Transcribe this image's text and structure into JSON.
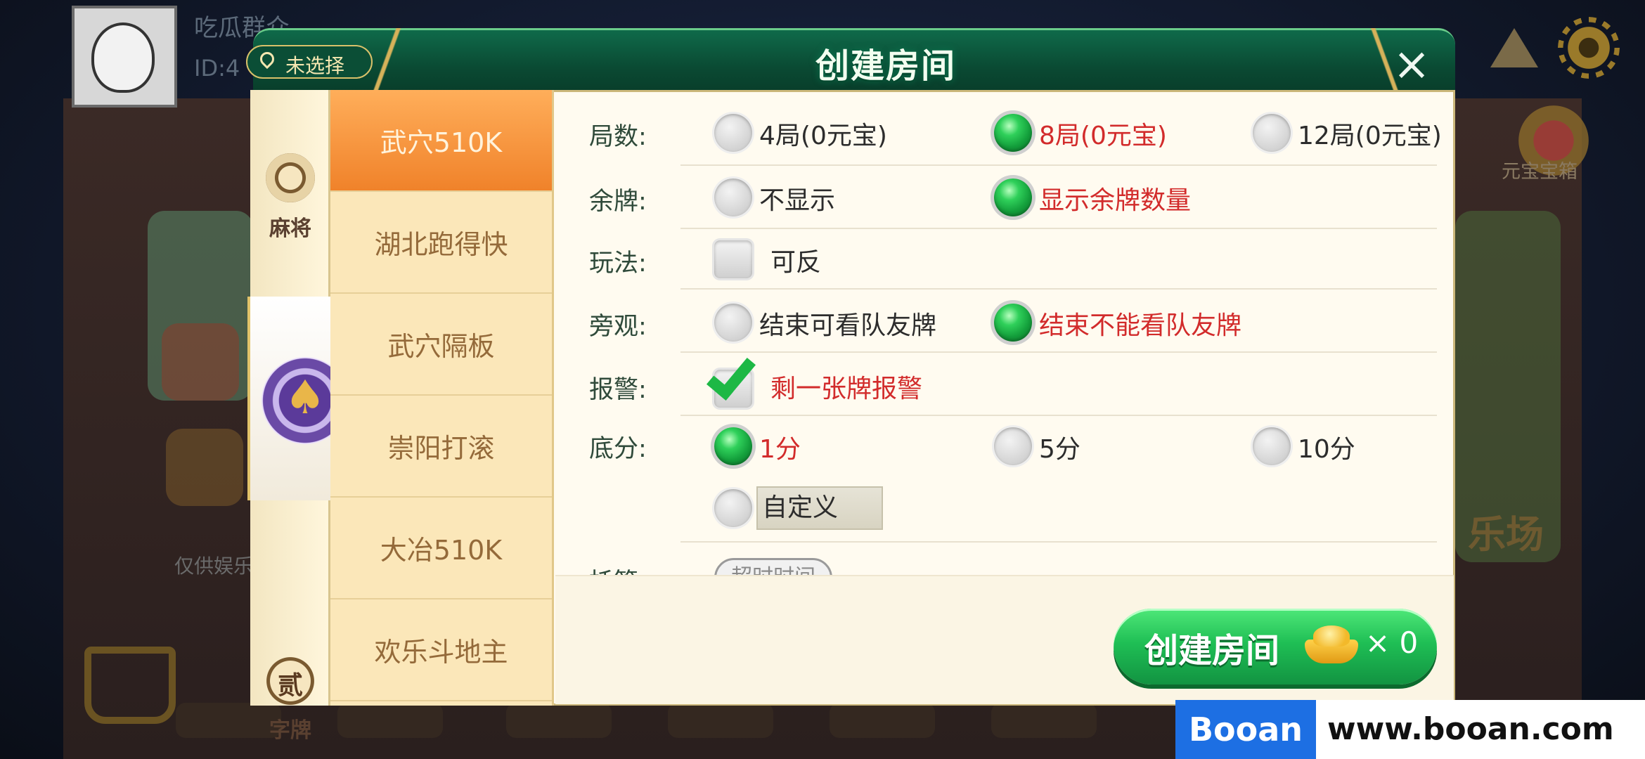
{
  "background": {
    "player_name": "吃瓜群众",
    "player_id": "ID:4",
    "treasure_label": "元宝宝箱",
    "left_caption": "仅供娱乐",
    "right_label": "乐场"
  },
  "header": {
    "title": "创建房间",
    "location_label": "未选择",
    "close_label": "×"
  },
  "categories": [
    {
      "label": "麻将",
      "icon": "mahjong-emblem-icon"
    },
    {
      "label": "",
      "icon": "spade-badge-icon",
      "selected": true
    },
    {
      "label": "字牌",
      "icon": "er-character-emblem-icon",
      "emblem_text": "贰"
    }
  ],
  "games": [
    {
      "label": "武穴510K",
      "selected": true
    },
    {
      "label": "湖北跑得快"
    },
    {
      "label": "武穴隔板"
    },
    {
      "label": "崇阳打滚"
    },
    {
      "label": "大冶510K"
    },
    {
      "label": "欢乐斗地主"
    }
  ],
  "options": {
    "rounds": {
      "label": "局数:",
      "choices": [
        {
          "text": "4局(0元宝)",
          "selected": false
        },
        {
          "text": "8局(0元宝)",
          "selected": true
        },
        {
          "text": "12局(0元宝)",
          "selected": false
        }
      ]
    },
    "remaining_cards": {
      "label": "余牌:",
      "choices": [
        {
          "text": "不显示",
          "selected": false
        },
        {
          "text": "显示余牌数量",
          "selected": true
        }
      ]
    },
    "play_style": {
      "label": "玩法:",
      "checkbox": {
        "text": "可反",
        "checked": false
      }
    },
    "spectate": {
      "label": "旁观:",
      "choices": [
        {
          "text": "结束可看队友牌",
          "selected": false
        },
        {
          "text": "结束不能看队友牌",
          "selected": true
        }
      ]
    },
    "alarm": {
      "label": "报警:",
      "checkbox": {
        "text": "剩一张牌报警",
        "checked": true
      }
    },
    "base_score": {
      "label": "底分:",
      "choices": [
        {
          "text": "1分",
          "selected": true
        },
        {
          "text": "5分",
          "selected": false
        },
        {
          "text": "10分",
          "selected": false
        },
        {
          "text": "",
          "selected": false
        }
      ],
      "custom_value": "自定义"
    },
    "trustee": {
      "label": "托管:",
      "pill_text": "超时时间"
    }
  },
  "footer": {
    "create_label": "创建房间",
    "cost_text": "× 0",
    "currency_icon": "gold-ingot-icon"
  },
  "watermark": {
    "brand": "Booan",
    "url": "www.booan.com"
  },
  "colors": {
    "header_green": "#0a4a33",
    "selected_tab": "#f0822a",
    "selected_text": "#d22b2b",
    "button_green": "#1fbf55",
    "watermark_blue": "#1d6fe3"
  }
}
